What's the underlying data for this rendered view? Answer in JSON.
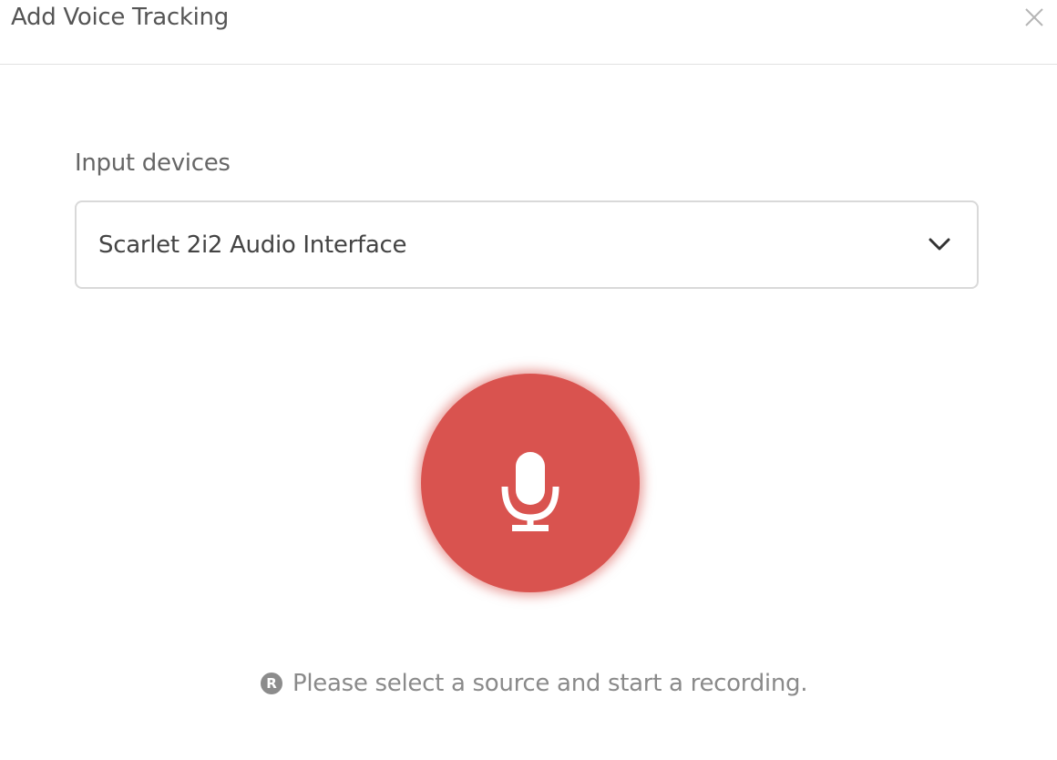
{
  "dialog": {
    "title": "Add Voice Tracking",
    "close_icon": "close-icon"
  },
  "input_devices": {
    "label": "Input devices",
    "selected": "Scarlet 2i2 Audio Interface",
    "dropdown_icon": "chevron-down-icon"
  },
  "record": {
    "icon": "microphone-icon",
    "color": "#d9534f"
  },
  "status": {
    "badge": "R",
    "message": "Please select a source and start a recording."
  }
}
